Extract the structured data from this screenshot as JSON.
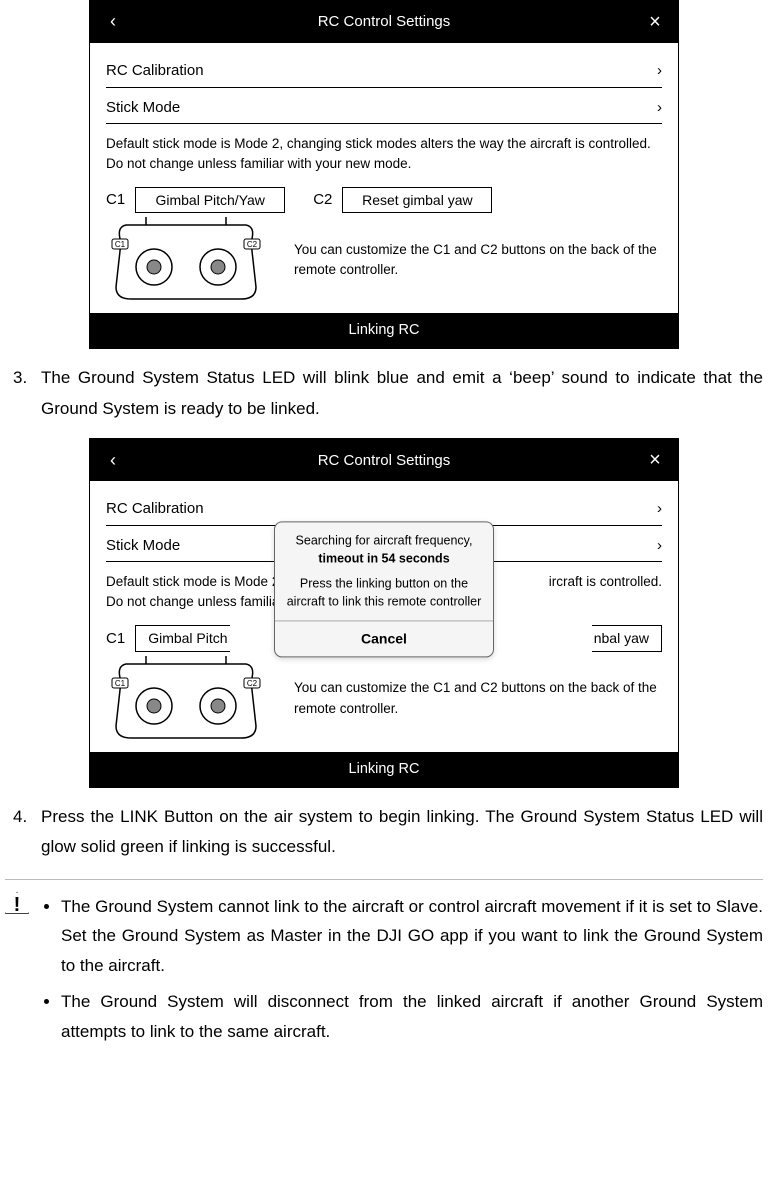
{
  "shot1": {
    "header_title": "RC Control Settings",
    "rc_calibration_label": "RC Calibration",
    "stick_mode_label": "Stick Mode",
    "stick_note": "Default stick mode is Mode 2, changing stick modes alters the way the aircraft is controlled. Do not change unless familiar with your new mode.",
    "c1_label": "C1",
    "c1_value": "Gimbal Pitch/Yaw",
    "c2_label": "C2",
    "c2_value": "Reset gimbal yaw",
    "controller_note": "You can customize the C1 and C2 buttons on the back of the remote controller.",
    "linking_label": "Linking RC",
    "c1_tag": "C1",
    "c2_tag": "C2"
  },
  "step3": {
    "num": "3.",
    "text": "The Ground System Status LED will blink blue and emit a ‘beep’ sound to indicate that the Ground System is ready to be linked."
  },
  "shot2": {
    "header_title": "RC Control Settings",
    "rc_calibration_label": "RC Calibration",
    "stick_mode_label": "Stick Mode",
    "stick_note_left": "Default stick mode is Mode 2",
    "stick_note_left2": "Do not change unless familia",
    "stick_note_right": "ircraft is controlled.",
    "c1_label": "C1",
    "c1_value_trunc": "Gimbal Pitch",
    "c2_value_trunc": "nbal yaw",
    "controller_note": "You can customize the C1 and C2 buttons on the back of the remote controller.",
    "linking_label": "Linking RC",
    "c1_tag": "C1",
    "c2_tag": "C2",
    "modal_line1": "Searching for aircraft frequency,",
    "modal_line2": "timeout in 54 seconds",
    "modal_line3": "Press the linking button on the aircraft to link this remote controller",
    "modal_cancel": "Cancel"
  },
  "step4": {
    "num": "4.",
    "text": "Press the LINK Button on the air system to begin linking. The Ground System Status LED will glow solid green if linking is successful."
  },
  "callout": {
    "warn_icon": "!",
    "bullet1": "The Ground System cannot link to the aircraft or control aircraft movement if it is set to Slave. Set the Ground System as Master in the DJI GO app if you want to link the Ground System to the aircraft.",
    "bullet2": "The Ground System will disconnect from the linked aircraft if another Ground System attempts to link to the same aircraft."
  }
}
